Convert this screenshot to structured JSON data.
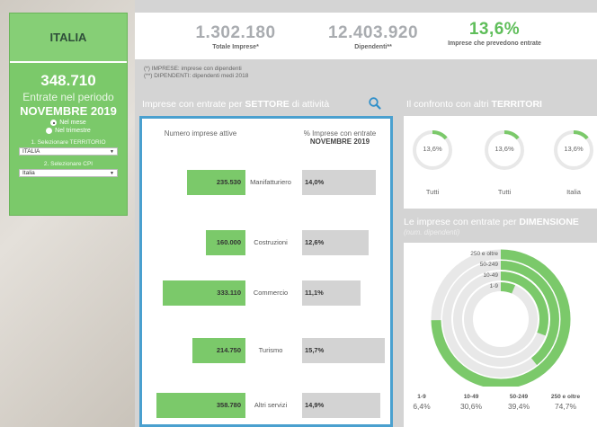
{
  "sidebar": {
    "region": "ITALIA",
    "total": "348.710",
    "entries_label": "Entrate nel periodo",
    "period": "NOVEMBRE 2019",
    "radio_month": "Nel mese",
    "radio_quarter": "Nel trimestre",
    "territory_label": "1. Selezionare TERRITORIO",
    "territory_value": "ITALIA",
    "cpi_label": "2. Selezionare CPI",
    "cpi_value": "Italia"
  },
  "kpis": [
    {
      "value": "1.302.180",
      "label": "Totale Imprese*"
    },
    {
      "value": "12.403.920",
      "label": "Dipendenti**"
    },
    {
      "value": "13,6%",
      "label": "Imprese che prevedono entrate"
    }
  ],
  "notes": {
    "imprese": "(*)  IMPRESE: imprese con dipendenti",
    "dipendenti": "(**) DIPENDENTI: dipendenti medi 2018"
  },
  "sector": {
    "title_prefix": "Imprese con entrate per ",
    "title_bold": "SETTORE",
    "title_suffix": " di attività",
    "col_left": "Numero imprese attive",
    "col_right_top": "% Imprese con entrate",
    "col_right_bottom": "NOVEMBRE 2019",
    "rows": [
      {
        "name": "Manifatturiero",
        "count": "235.530",
        "count_value": 235530,
        "pct": "14,0%",
        "pct_value": 14.0
      },
      {
        "name": "Costruzioni",
        "count": "160.000",
        "count_value": 160000,
        "pct": "12,6%",
        "pct_value": 12.6
      },
      {
        "name": "Commercio",
        "count": "333.110",
        "count_value": 333110,
        "pct": "11,1%",
        "pct_value": 11.1
      },
      {
        "name": "Turismo",
        "count": "214.750",
        "count_value": 214750,
        "pct": "15,7%",
        "pct_value": 15.7
      },
      {
        "name": "Altri servizi",
        "count": "358.780",
        "count_value": 358780,
        "pct": "14,9%",
        "pct_value": 14.9
      }
    ]
  },
  "territories": {
    "title_prefix": "Il confronto con altri ",
    "title_bold": "TERRITORI",
    "items": [
      {
        "value": "13,6%",
        "pct": 13.6,
        "label": "Tutti"
      },
      {
        "value": "13,6%",
        "pct": 13.6,
        "label": "Tutti"
      },
      {
        "value": "13,6%",
        "pct": 13.6,
        "label": "Italia"
      }
    ]
  },
  "dimension": {
    "title_prefix": "Le imprese con entrate per ",
    "title_bold": "DIMENSIONE",
    "subtitle": "(num. dipendenti)",
    "rings": [
      {
        "key": "250 e oltre",
        "value": "74,7%",
        "pct": 74.7
      },
      {
        "key": "50-249",
        "value": "39,4%",
        "pct": 39.4
      },
      {
        "key": "10-49",
        "value": "30,6%",
        "pct": 30.6
      },
      {
        "key": "1-9",
        "value": "6,4%",
        "pct": 6.4
      }
    ],
    "legend": [
      {
        "key": "1-9",
        "value": "6,4%"
      },
      {
        "key": "10-49",
        "value": "30,6%"
      },
      {
        "key": "50-249",
        "value": "39,4%"
      },
      {
        "key": "250 e oltre",
        "value": "74,7%"
      }
    ]
  },
  "colors": {
    "green": "#7bc96a",
    "accent_blue": "#4aa0cf",
    "grey_bar": "#d3d3d3",
    "ring_track": "#e8e8e8"
  },
  "icons": {
    "search": "search-icon"
  }
}
